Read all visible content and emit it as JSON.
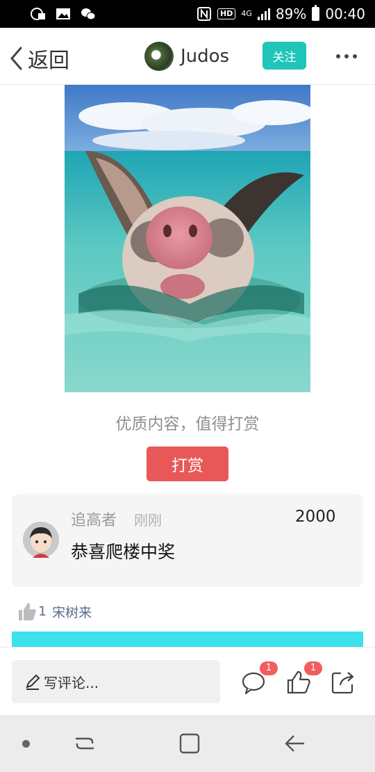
{
  "status_bar": {
    "network_label": "4G",
    "hd_label": "HD",
    "battery": "89%",
    "time": "00:40"
  },
  "header": {
    "back_label": "返回",
    "author_name": "Judos",
    "follow_label": "关注"
  },
  "post": {
    "image_icon": "swimming-pig-photo",
    "reward_prompt": "优质内容，值得打赏",
    "reward_button": "打赏"
  },
  "reward_comment": {
    "user": "追高者",
    "time": "刚刚",
    "amount": "2000",
    "text": "恭喜爬楼中奖"
  },
  "likes": {
    "count": "1",
    "names": "宋树来"
  },
  "actions": {
    "comment_placeholder": "写评论...",
    "comment_badge": "1",
    "like_badge": "1"
  },
  "colors": {
    "accent_follow": "#1fc5b8",
    "reward_red": "#e95858",
    "badge_red": "#f25d5d",
    "link_blue": "#5b6c8e"
  }
}
